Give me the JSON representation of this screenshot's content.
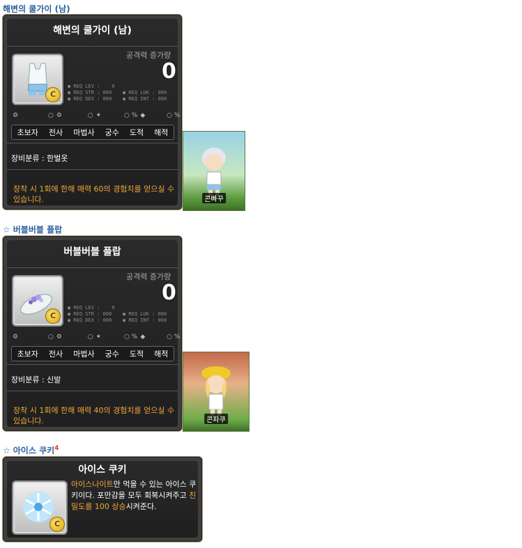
{
  "sections": [
    {
      "heading": "해변의 쿨가이 (남)",
      "name": "해변의 쿨가이 (남)",
      "attack_label": "공격력 증가량",
      "attack_value": "0",
      "req_left": "● REQ LEV :    0\n● REQ STR : 000\n● REQ DEX : 000",
      "req_right": "\n● REQ LUK : 000\n● REQ INT : 000",
      "mini_stats": [
        "○",
        "○",
        "○ %",
        "○ %"
      ],
      "jobs": [
        "초보자",
        "전사",
        "마법사",
        "궁수",
        "도적",
        "해적"
      ],
      "category": "장비분류 : 한벌옷",
      "description": "장착 시 1회에 한해 매력 60의 경험치를 얻으실 수 있습니다.",
      "avatar_name": "콘빠꾸"
    },
    {
      "heading": "버블버블 플랍",
      "name": "버블버블 플랍",
      "attack_label": "공격력 증가량",
      "attack_value": "0",
      "req_left": "● REQ LEV :    0\n● REQ STR : 000\n● REQ DEX : 000",
      "req_right": "\n● REQ LUK : 000\n● REQ INT : 000",
      "mini_stats": [
        "○",
        "○",
        "○ %",
        "○ %"
      ],
      "jobs": [
        "초보자",
        "전사",
        "마법사",
        "궁수",
        "도적",
        "해적"
      ],
      "category": "장비분류 : 신발",
      "description": "장착 시 1회에 한해 매력 40의 경험치를 얻으실 수 있습니다.",
      "avatar_name": "콘파쿠"
    },
    {
      "heading": "아이스 쿠키",
      "heading_sup": "4",
      "name": "아이스 쿠키",
      "desc_hl1": "아이스나이트",
      "desc_p1": "만 먹을 수 있는 아이스 쿠키이다. 포만감을 모두 회복시켜주고 ",
      "desc_hl2": "친밀도를 100 상승",
      "desc_p2": "시켜준다."
    }
  ],
  "colors": {
    "accent": "#2a5f9e",
    "highlight": "#f0a83a"
  }
}
